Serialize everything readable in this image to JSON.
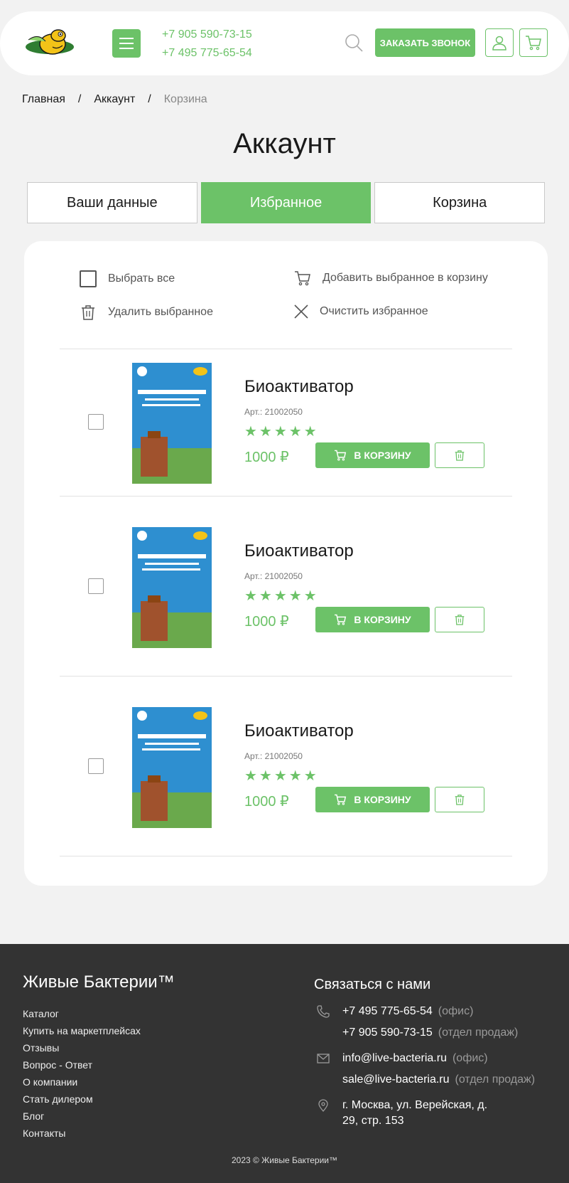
{
  "header": {
    "phones": [
      "+7 905 590-73-15",
      "+7 495 775-65-54"
    ],
    "call_button": "ЗАКАЗАТЬ ЗВОНОК",
    "accent": "#6cc268"
  },
  "breadcrumb": [
    "Главная",
    "Аккаунт",
    "Корзина"
  ],
  "page_title": "Аккаунт",
  "tabs": [
    {
      "label": "Ваши данные",
      "active": false
    },
    {
      "label": "Избранное",
      "active": true
    },
    {
      "label": "Корзина",
      "active": false
    }
  ],
  "actions": {
    "select_all": "Выбрать все",
    "add_selected": "Добавить выбранное в корзину",
    "delete_selected": "Удалить выбранное",
    "clear_favorites": "Очистить избранное"
  },
  "items": [
    {
      "name": "Биоактиватор",
      "sku": "Арт.: 21002050",
      "rating": 5,
      "stars": "★★★★★",
      "price": "1000 ₽",
      "cart_label": "В КОРЗИНУ"
    },
    {
      "name": "Биоактиватор",
      "sku": "Арт.: 21002050",
      "rating": 5,
      "stars": "★★★★★",
      "price": "1000 ₽",
      "cart_label": "В КОРЗИНУ"
    },
    {
      "name": "Биоактиватор",
      "sku": "Арт.: 21002050",
      "rating": 5,
      "stars": "★★★★★",
      "price": "1000 ₽",
      "cart_label": "В КОРЗИНУ"
    }
  ],
  "footer": {
    "brand": "Живые Бактерии™",
    "links": [
      "Каталог",
      "Купить на маркетплейсах",
      "Отзывы",
      "Вопрос - Ответ",
      "О компании",
      "Стать дилером",
      "Блог",
      "Контакты"
    ],
    "contact_title": "Связаться с нами",
    "phones": [
      {
        "value": "+7 495 775-65-54",
        "note": "(офис)"
      },
      {
        "value": "+7 905 590-73-15",
        "note": "(отдел продаж)"
      }
    ],
    "emails": [
      {
        "value": "info@live-bacteria.ru",
        "note": "(офис)"
      },
      {
        "value": "sale@live-bacteria.ru",
        "note": "(отдел продаж)"
      }
    ],
    "address_line1": "г. Москва, ул. Верейская, д.",
    "address_line2": "29, стр. 153",
    "copyright": "2023 © Живые Бактерии™"
  }
}
